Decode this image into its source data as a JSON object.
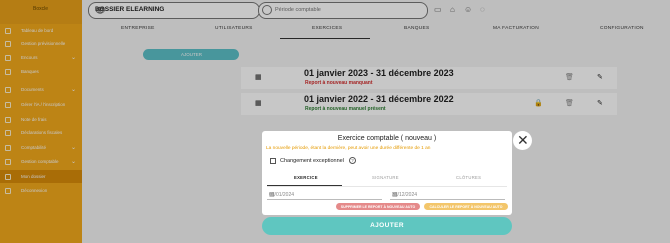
{
  "brand": {
    "logo_text": "Boxcle"
  },
  "sidebar": {
    "items": [
      {
        "label": "Tableau de bord",
        "chevron": ""
      },
      {
        "label": "Gestion prévisionnelle",
        "chevron": ""
      },
      {
        "label": "Encours",
        "chevron": "⌄"
      },
      {
        "label": "Banques",
        "chevron": ""
      },
      {
        "label": "Documents",
        "chevron": "⌄"
      },
      {
        "label": "Gérer l'iA / l'inscription",
        "chevron": ""
      },
      {
        "label": "Note de frais",
        "chevron": ""
      },
      {
        "label": "Déclarations fiscales",
        "chevron": ""
      },
      {
        "label": "Comptabilité",
        "chevron": "⌄"
      },
      {
        "label": "Gestion comptable",
        "chevron": "⌄"
      },
      {
        "label": "Mon dossier",
        "chevron": ""
      },
      {
        "label": "Déconnexion",
        "chevron": ""
      }
    ]
  },
  "topbar": {
    "dossier_name": "DOSSIER ELEARNING",
    "search_placeholder": "Période comptable"
  },
  "tabs": [
    "ENTREPRISE",
    "UTILISATEURS",
    "EXERCICES",
    "BANQUES",
    "MA FACTURATION",
    "CONFIGURATION"
  ],
  "actions": {
    "ajouter_top": "AJOUTER",
    "ajouter_main": "AJOUTER"
  },
  "exercices": [
    {
      "title": "01 janvier 2023 - 31 décembre 2023",
      "status": "Report à nouveau manquant",
      "status_color": "#d32f2f"
    },
    {
      "title": "01 janvier 2022 - 31 décembre 2022",
      "status": "Report à nouveau manuel présent",
      "status_color": "#2e7d32"
    }
  ],
  "modal": {
    "title": "Exercice comptable ( nouveau )",
    "warning": "La nouvelle période, étant la dernière, peut avoir une durée différente de 1 an",
    "checkbox_label": "Changement exceptionnel",
    "help": "?",
    "tabs": [
      "EXERCICE",
      "SIGNATURE",
      "CLÔTURES"
    ],
    "start_date": "01/01/2024",
    "end_date": "31/12/2024",
    "btn_delete": "SUPPRIMER LE REPORT À NOUVEAU AUTO",
    "btn_generate": "CALCULER LE REPORT À NOUVEAU AUTO"
  },
  "colors": {
    "sidebar": "#f2a91c",
    "accent": "#5fc6c0",
    "warning": "#e59a00"
  }
}
